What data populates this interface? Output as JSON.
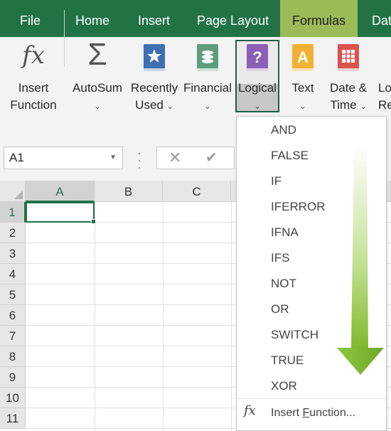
{
  "tabs": [
    "File",
    "Home",
    "Insert",
    "Page Layout",
    "Formulas",
    "Dat"
  ],
  "active_tab": "Formulas",
  "ribbon": {
    "insert_function": {
      "line1": "Insert",
      "line2": "Function"
    },
    "autosum": {
      "line1": "AutoSum",
      "caret": "⌄"
    },
    "recently_used": {
      "line1": "Recently",
      "line2": "Used",
      "caret": "⌄"
    },
    "financial": {
      "line1": "Financial",
      "caret": "⌄"
    },
    "logical": {
      "line1": "Logical",
      "caret": "⌄"
    },
    "text": {
      "line1": "Text",
      "caret": "⌄"
    },
    "date_time": {
      "line1": "Date &",
      "line2": "Time",
      "caret": "⌄"
    },
    "lookup": {
      "line1": "Lo",
      "line2": "Ref"
    }
  },
  "name_box": "A1",
  "columns": [
    "A",
    "B",
    "C"
  ],
  "rows": [
    "1",
    "2",
    "3",
    "4",
    "5",
    "6",
    "7",
    "8",
    "9",
    "10",
    "11"
  ],
  "logical_menu": {
    "items": [
      "AND",
      "FALSE",
      "IF",
      "IFERROR",
      "IFNA",
      "IFS",
      "NOT",
      "OR",
      "SWITCH",
      "TRUE",
      "XOR"
    ],
    "insert_function_prefix": "Insert ",
    "insert_function_underline": "F",
    "insert_function_suffix": "unction..."
  },
  "colors": {
    "tab_bar": "#217346",
    "active_tab": "#9bbb59",
    "arrow": "#8dc63f"
  }
}
